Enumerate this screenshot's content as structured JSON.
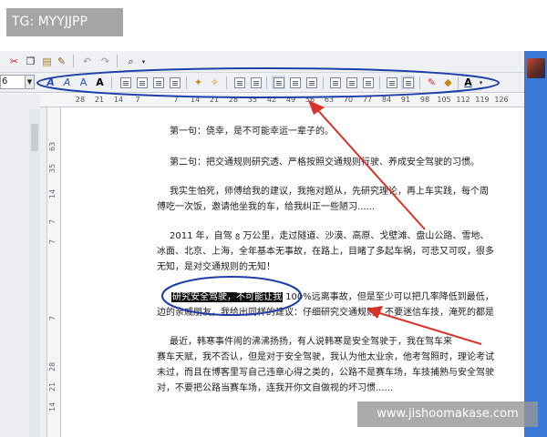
{
  "watermark_tag": "TG: MYYJJPP",
  "watermark_url": "www.jishoomakase.com",
  "toolbar": {
    "font_size": "6"
  },
  "ruler": {
    "horizontal_ticks": [
      "28",
      "21",
      "14",
      "7",
      "",
      "7",
      "14",
      "21",
      "28",
      "35",
      "42",
      "49",
      "56",
      "63",
      "70",
      "77",
      "84",
      "91",
      "98",
      "105",
      "112",
      "119",
      "126"
    ],
    "vertical_ticks": [
      "63",
      "35",
      "14",
      "7",
      "7",
      "7",
      "28",
      "21",
      "14"
    ]
  },
  "document": {
    "line1": "第一句：侥幸，是不可能幸运一辈子的。",
    "line2": "第二句：把交通规则研究透、严格按照交通规则行驶、养成安全驾驶的习惯。",
    "line3a": "我实生怕死，师傅给我的建议，我拖对题从，先研究理论，再上车实践，每个周",
    "line3b": "傅吃一次饭，邀请他坐我的车，给我纠正一些陋习......",
    "line4a_pre": "2011 年，自驾 ",
    "line4a_num": "8",
    "line4a_post": " 万公里，走过隧道、沙漠、高原、戈壁滩、盘山公路、雪地、",
    "line4b": "冰面、北京、上海，全年基本无事故，在路上，目睹了多起车祸，可悲又可叹，很多",
    "line4c": "无知，是对交通规则的无知！",
    "line5_highlight": "研究安全驾驶，不可能让我",
    "line5_rest": " 100%远离事故，但是至少可以把几率降低到最低，",
    "line5b": "边的亲戚朋友，我给出同样的建议：仔细研究交通规则，不要迷信车技，淹死的都是",
    "line6a": "最近，韩寒事件闹的沸沸扬扬，有人说韩寒是安全驾驶于，我在驾车来",
    "line6b": "赛车天赋，我不否认，但是对于安全驾驶，我认为他太业余，他考驾照时，理论考试",
    "line6c": "未过，而且在博客里写自己违章心得之类的，公路不是赛车场，车技捕熟与安全驾驶",
    "line6d": "对，不要把公路当赛车场，连我开你文自做视的坏习惯......"
  },
  "colors": {
    "annotation": "#1f3fa8",
    "arrow": "#d8322a",
    "right_strip": "#3a78d8"
  }
}
